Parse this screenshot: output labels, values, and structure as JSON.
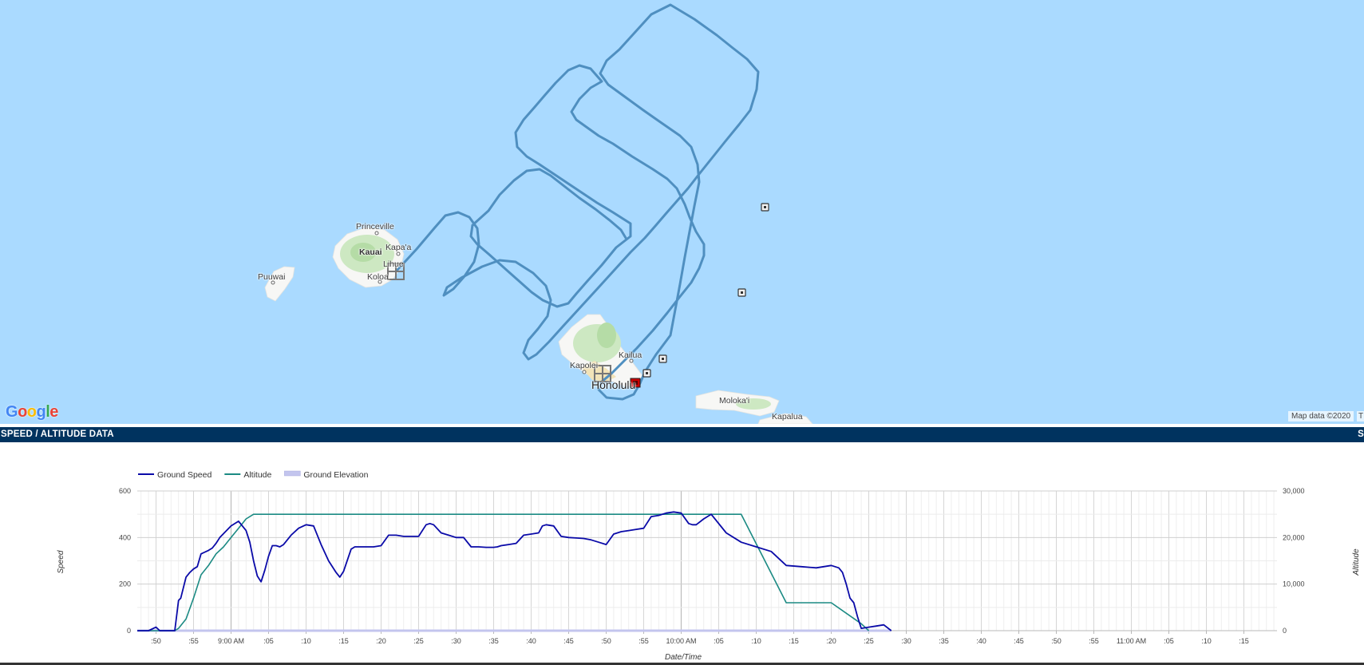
{
  "map": {
    "labels": {
      "princeville": "Princeville",
      "kauai": "Kauai",
      "kapaa": "Kapa'a",
      "lihue": "Lihue",
      "koloa": "Koloa",
      "puuwai": "Puuwai",
      "kailua": "Kailua",
      "kapolei": "Kapolei",
      "honolulu": "Honolulu",
      "molokai": "Moloka'i",
      "kapalua": "Kapalua"
    },
    "attribution": "Map data ©2020",
    "attribution_tail": "T",
    "logo": [
      "G",
      "o",
      "o",
      "g",
      "l",
      "e"
    ],
    "route_color": "#4f8fc0",
    "destination_marker_color": "#cc0000"
  },
  "section": {
    "title": "SPEED / ALTITUDE DATA",
    "right_mark": "S"
  },
  "chart_data": {
    "type": "line",
    "title": "",
    "xlabel": "Date/Time",
    "ylabel_left": "Speed",
    "ylabel_right": "Altitude",
    "ylim_left": [
      0,
      600
    ],
    "ylim_right": [
      0,
      30000
    ],
    "yticks_left": [
      "0",
      "200",
      "400",
      "600"
    ],
    "yticks_right": [
      "0",
      "10,000",
      "20,000",
      "30,000"
    ],
    "grid": true,
    "legend_position": "top-left",
    "x_tick_labels": [
      ":50",
      ":55",
      "9:00 AM",
      ":05",
      ":10",
      ":15",
      ":20",
      ":25",
      ":30",
      ":35",
      ":40",
      ":45",
      ":50",
      ":55",
      "10:00 AM",
      ":05",
      ":10",
      ":15",
      ":20",
      ":25",
      ":30",
      ":35",
      ":40",
      ":45",
      ":50",
      ":55",
      "11:00 AM",
      ":05",
      ":10",
      ":15"
    ],
    "x_unit": "minutes since 8:00 AM",
    "x_range": [
      47.5,
      123.5
    ],
    "series": [
      {
        "name": "Ground Speed",
        "axis": "left",
        "color": "#0a0aa8",
        "x": [
          47.5,
          49,
          50,
          50.5,
          51,
          51.5,
          52.5,
          53,
          53.3,
          54,
          54.5,
          55,
          55.5,
          56,
          57,
          57.5,
          58,
          58.5,
          60,
          61,
          62,
          62.5,
          63,
          63.5,
          64,
          64.5,
          65,
          65.5,
          66,
          66.5,
          67,
          68,
          69,
          70,
          71,
          72,
          73,
          74,
          74.5,
          75,
          76,
          76.5,
          77,
          77.5,
          78,
          79,
          80,
          81,
          82,
          83,
          84,
          85,
          86,
          86.5,
          87,
          88,
          89,
          90,
          91,
          92,
          93,
          94,
          95,
          95.5,
          96,
          97,
          98,
          99,
          100,
          101,
          101.5,
          102,
          103,
          104,
          105,
          106,
          107,
          108,
          109,
          110,
          111,
          112,
          113,
          114,
          115,
          116,
          117,
          118,
          119,
          120,
          121,
          121.5,
          122,
          123
        ],
        "y": [
          0,
          0,
          15,
          0,
          0,
          0,
          0,
          130,
          140,
          230,
          250,
          265,
          275,
          330,
          345,
          355,
          375,
          400,
          450,
          470,
          430,
          380,
          300,
          235,
          210,
          260,
          320,
          365,
          365,
          360,
          370,
          410,
          440,
          455,
          450,
          370,
          300,
          250,
          230,
          255,
          350,
          360,
          360,
          360,
          360,
          360,
          365,
          410,
          410,
          405,
          405,
          405,
          455,
          460,
          455,
          420,
          410,
          400,
          400,
          360,
          360,
          358,
          358,
          360,
          365,
          370,
          375,
          410,
          415,
          420,
          450,
          455,
          450,
          405,
          400,
          398,
          396,
          390,
          380,
          370,
          415,
          425,
          430,
          435,
          440,
          490,
          495,
          505,
          510,
          505,
          460,
          455,
          455,
          480
        ],
        "y_tail_x": [
          124,
          126,
          128,
          130,
          132,
          134,
          136,
          138,
          140,
          141,
          141.5,
          142,
          142.5,
          143,
          143.5,
          144,
          145,
          146,
          147,
          148
        ],
        "y_tail": [
          500,
          420,
          380,
          360,
          340,
          280,
          275,
          270,
          280,
          270,
          250,
          200,
          140,
          120,
          60,
          10,
          15,
          20,
          25,
          0
        ]
      },
      {
        "name": "Altitude",
        "axis": "right",
        "color": "#1b8a83",
        "x": [
          47.5,
          52.5,
          53,
          54,
          55,
          56,
          57,
          58,
          59,
          60,
          61,
          62,
          63,
          64,
          70,
          80,
          90,
          100,
          110,
          120,
          128,
          134,
          138,
          140,
          144,
          145
        ],
        "y": [
          0,
          0,
          500,
          2500,
          7000,
          12000,
          14000,
          16500,
          18000,
          20000,
          22000,
          24000,
          25000,
          25000,
          25000,
          25000,
          25000,
          25000,
          25000,
          25000,
          25000,
          6000,
          6000,
          6000,
          1500,
          0
        ]
      },
      {
        "name": "Ground Elevation",
        "axis": "right",
        "color": "#c3c5ee",
        "x": [
          47.5,
          148
        ],
        "y": [
          0,
          0
        ]
      }
    ]
  }
}
